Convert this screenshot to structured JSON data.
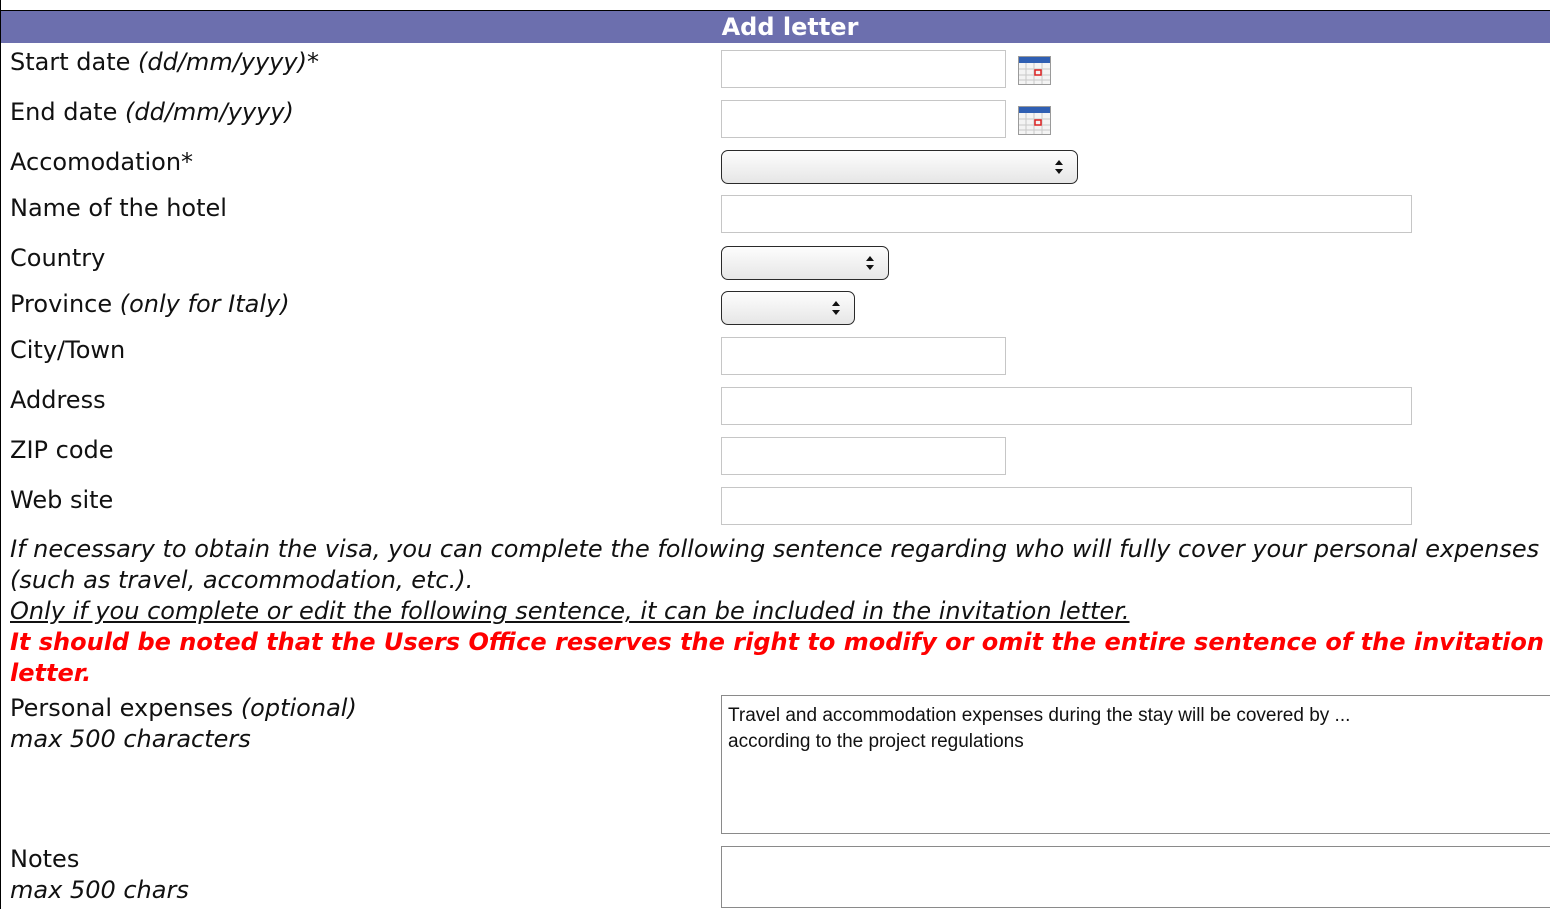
{
  "form": {
    "title": "Add letter",
    "fields": {
      "start_date": {
        "label": "Start date ",
        "hint": "(dd/mm/yyyy)*",
        "value": ""
      },
      "end_date": {
        "label": "End date ",
        "hint": "(dd/mm/yyyy)",
        "value": ""
      },
      "accommodation": {
        "label": "Accomodation*",
        "selected": ""
      },
      "hotel_name": {
        "label": "Name of the hotel",
        "value": ""
      },
      "country": {
        "label": "Country",
        "selected": ""
      },
      "province": {
        "label": "Province ",
        "hint": "(only for Italy)",
        "selected": ""
      },
      "city": {
        "label": "City/Town",
        "value": ""
      },
      "address": {
        "label": "Address",
        "value": ""
      },
      "zip": {
        "label": "ZIP code",
        "value": ""
      },
      "website": {
        "label": "Web site",
        "value": ""
      }
    },
    "visa_info": {
      "intro": "If necessary to obtain the visa, you can complete the following sentence regarding who will fully cover your personal expenses (such as travel, accommodation, etc.).",
      "condition": "Only if you complete or edit the following sentence, it can be included in the invitation letter.",
      "warning": "It should be noted that the Users Office reserves the right to modify or omit the entire sentence of the invitation letter."
    },
    "personal_expenses": {
      "label": "Personal expenses ",
      "hint": "(optional)",
      "limit": "max 500 characters",
      "value": "Travel and accommodation expenses during the stay will be covered by ...\naccording to the project regulations"
    },
    "notes": {
      "label": "Notes",
      "limit": "max 500 chars",
      "value": ""
    }
  },
  "icons": {
    "calendar": "calendar-icon",
    "select_arrows": "up-down-arrows-icon"
  },
  "colors": {
    "header_bg": "#6c6fae",
    "warning_text": "#ff0000"
  }
}
